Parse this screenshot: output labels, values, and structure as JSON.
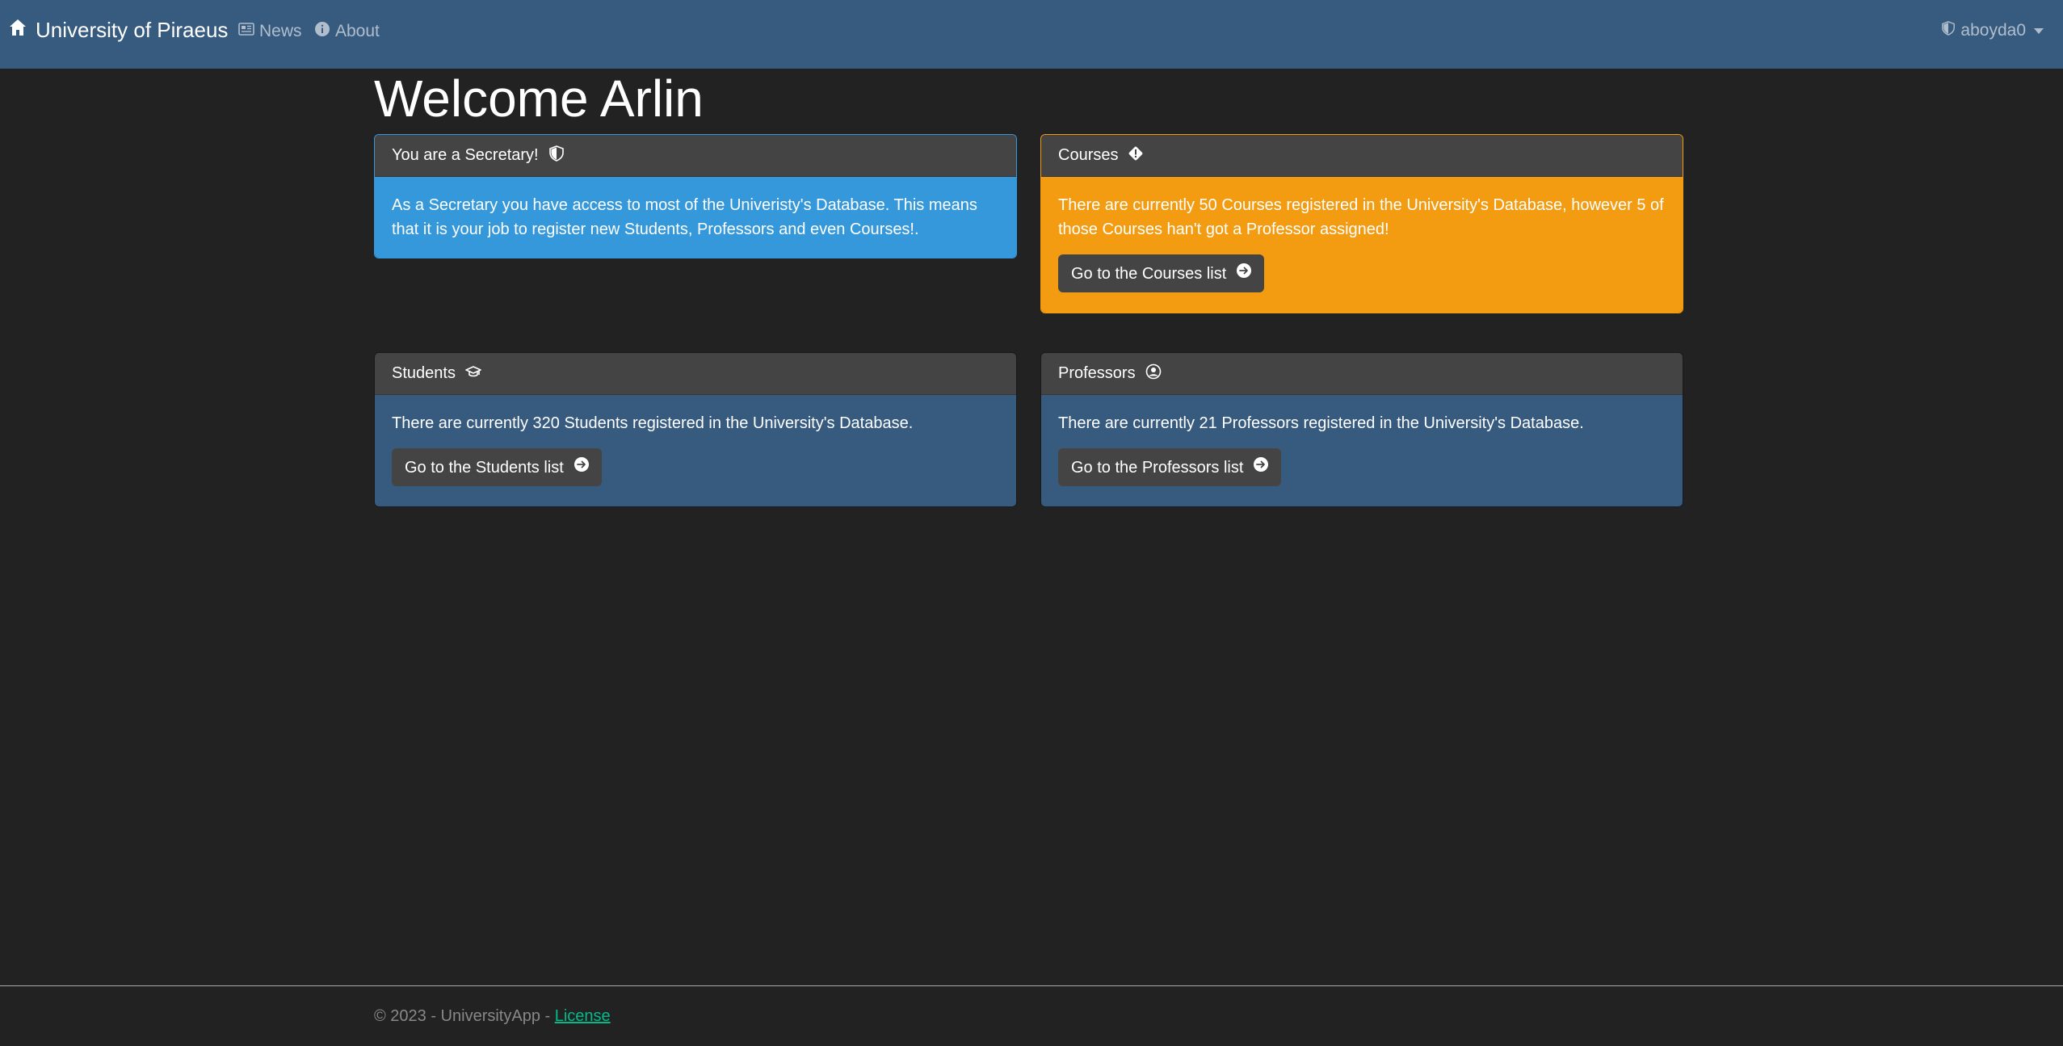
{
  "navbar": {
    "brand": "University of Piraeus",
    "links": [
      {
        "label": "News",
        "icon": "newspaper-icon"
      },
      {
        "label": "About",
        "icon": "info-circle-icon"
      }
    ],
    "user": {
      "name": "aboyda0",
      "icon": "shield-icon"
    }
  },
  "main": {
    "title": "Welcome Arlin",
    "cards": {
      "secretary": {
        "header": "You are a Secretary!",
        "icon": "shield-icon",
        "body": "As a Secretary you have access to most of the Univeristy's Database. This means that it is your job to register new Students, Professors and even Courses!."
      },
      "courses": {
        "header": "Courses",
        "icon": "warning-diamond-icon",
        "body": "There are currently 50 Courses registered in the University's Database, however 5 of those Courses han't got a Professor assigned!",
        "button": "Go to the Courses list"
      },
      "students": {
        "header": "Students",
        "icon": "graduation-cap-icon",
        "body": "There are currently 320 Students registered in the University's Database.",
        "button": "Go to the Students list"
      },
      "professors": {
        "header": "Professors",
        "icon": "user-circle-icon",
        "body": "There are currently 21 Professors registered in the University's Database.",
        "button": "Go to the Professors list"
      }
    }
  },
  "footer": {
    "text": "© 2023 - UniversityApp - ",
    "link": "License"
  },
  "colors": {
    "navbar": "#375a7f",
    "background": "#222222",
    "info": "#3498db",
    "warning": "#f39c12",
    "card_header": "#444444",
    "link": "#00bc8c"
  }
}
